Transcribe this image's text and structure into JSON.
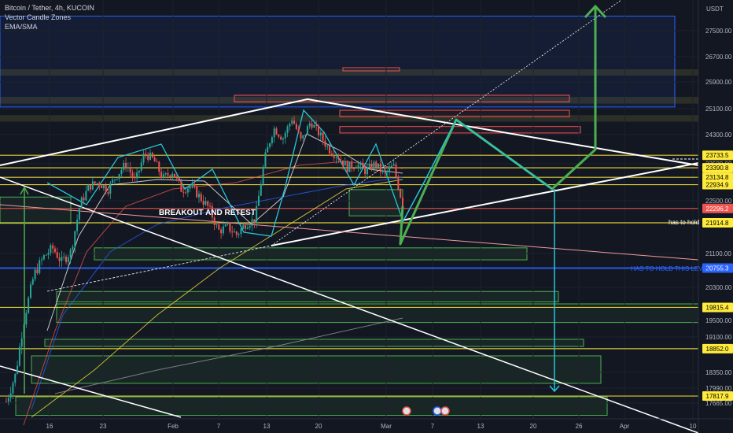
{
  "legend": {
    "symbol_line": "Bitcoin / Tether, 4h, KUCOIN",
    "indicator_1": "Vector Candle Zones",
    "indicator_2": "EMA/SMA"
  },
  "currency": "USDT",
  "colors": {
    "background": "#131722",
    "bull": "#26a69a",
    "bear": "#ef5350",
    "level_yellow": "#ffeb3b",
    "level_blue": "#2962ff",
    "projection_green": "#4caf50",
    "projection_cyan": "#26c6da",
    "pattern_white": "#ffffff"
  },
  "chart_data": {
    "type": "candlestick",
    "title": "",
    "xlabel": "",
    "ylabel": "",
    "ylim": [
      17500,
      27800
    ],
    "y_ticks": [
      27500,
      26700,
      25900,
      25100,
      24300,
      23500,
      22500,
      21100,
      20300,
      19500,
      19100,
      18350,
      17990,
      17665
    ],
    "x_ticks": [
      "16",
      "23",
      "Feb",
      "7",
      "13",
      "20",
      "Mar",
      "7",
      "13",
      "20",
      "26",
      "Apr",
      "10"
    ],
    "price_levels": [
      {
        "price": 23733.5,
        "label": "23733.5",
        "color": "#ffeb3b"
      },
      {
        "price": 23390.8,
        "label": "23390.8",
        "color": "#ffeb3b"
      },
      {
        "price": 23134.8,
        "label": "23134.8",
        "color": "#ffeb3b"
      },
      {
        "price": 22934.9,
        "label": "22934.9",
        "color": "#ffeb3b"
      },
      {
        "price": 22296.2,
        "label": "22296.2",
        "color": "#ef5350"
      },
      {
        "price": 21914.8,
        "label": "21914.8",
        "color": "#ffeb3b"
      },
      {
        "price": 20755.3,
        "label": "20755.3",
        "color": "#2962ff"
      },
      {
        "price": 19815.4,
        "label": "19815.4",
        "color": "#ffeb3b"
      },
      {
        "price": 18852.0,
        "label": "18852.0",
        "color": "#ffeb3b"
      },
      {
        "price": 17817.9,
        "label": "17817.9",
        "color": "#ffeb3b"
      }
    ],
    "close_path": [
      {
        "t": 0,
        "p": 17700
      },
      {
        "t": 1,
        "p": 18300
      },
      {
        "t": 2,
        "p": 19600
      },
      {
        "t": 3,
        "p": 20600
      },
      {
        "t": 4,
        "p": 21000
      },
      {
        "t": 5,
        "p": 21250
      },
      {
        "t": 6,
        "p": 20900
      },
      {
        "t": 7,
        "p": 21150
      },
      {
        "t": 8,
        "p": 22400
      },
      {
        "t": 9,
        "p": 22900
      },
      {
        "t": 10,
        "p": 23000
      },
      {
        "t": 11,
        "p": 22800
      },
      {
        "t": 12,
        "p": 23200
      },
      {
        "t": 13,
        "p": 23500
      },
      {
        "t": 14,
        "p": 23000
      },
      {
        "t": 15,
        "p": 23800
      },
      {
        "t": 16,
        "p": 23600
      },
      {
        "t": 17,
        "p": 23100
      },
      {
        "t": 18,
        "p": 23300
      },
      {
        "t": 19,
        "p": 22800
      },
      {
        "t": 20,
        "p": 22900
      },
      {
        "t": 21,
        "p": 22600
      },
      {
        "t": 22,
        "p": 22300
      },
      {
        "t": 23,
        "p": 21700
      },
      {
        "t": 24,
        "p": 21800
      },
      {
        "t": 25,
        "p": 21600
      },
      {
        "t": 26,
        "p": 21900
      },
      {
        "t": 27,
        "p": 22000
      },
      {
        "t": 28,
        "p": 23600
      },
      {
        "t": 29,
        "p": 24500
      },
      {
        "t": 30,
        "p": 24200
      },
      {
        "t": 31,
        "p": 24800
      },
      {
        "t": 32,
        "p": 24100
      },
      {
        "t": 33,
        "p": 24700
      },
      {
        "t": 34,
        "p": 24300
      },
      {
        "t": 35,
        "p": 23900
      },
      {
        "t": 36,
        "p": 23700
      },
      {
        "t": 37,
        "p": 23400
      },
      {
        "t": 38,
        "p": 23500
      },
      {
        "t": 39,
        "p": 23300
      },
      {
        "t": 40,
        "p": 23500
      },
      {
        "t": 41,
        "p": 23200
      },
      {
        "t": 42,
        "p": 23450
      },
      {
        "t": 43,
        "p": 22400
      }
    ]
  },
  "annotations": {
    "breakout_label": "BREAKOUT AND RETEST",
    "hold_label": "has to hold",
    "hold_level_label": "HAS TO HOLD THIS LEVEL"
  }
}
